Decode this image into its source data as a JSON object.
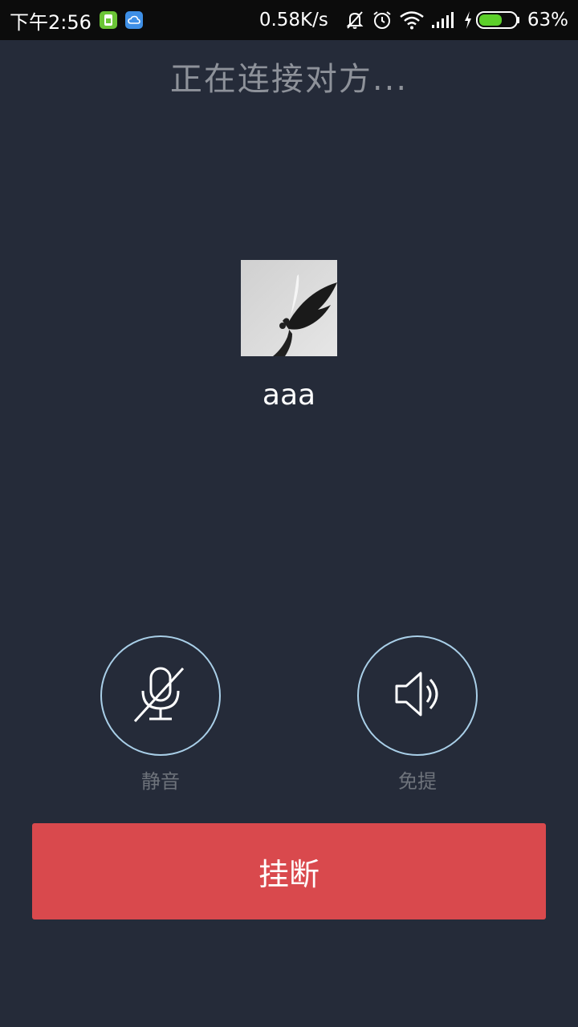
{
  "status_bar": {
    "time": "下午2:56",
    "network_speed": "0.58K/s",
    "battery_percent": "63%",
    "battery_level": 0.63,
    "icons": [
      "sim-card-icon",
      "cloud-icon",
      "bell-off-icon",
      "alarm-icon",
      "wifi-icon",
      "signal-icon",
      "charging-icon",
      "battery-icon"
    ]
  },
  "call": {
    "status_text": "正在连接对方...",
    "contact_name": "aaa"
  },
  "controls": {
    "mute_label": "静音",
    "speaker_label": "免提",
    "hangup_label": "挂断"
  },
  "colors": {
    "background": "#252b39",
    "status_bar": "#0c0c0c",
    "ring_border": "#a9cfe8",
    "hangup": "#d9494d",
    "label_gray": "#6e737b",
    "status_text": "#8e929a",
    "battery_green": "#5ccf2a"
  }
}
